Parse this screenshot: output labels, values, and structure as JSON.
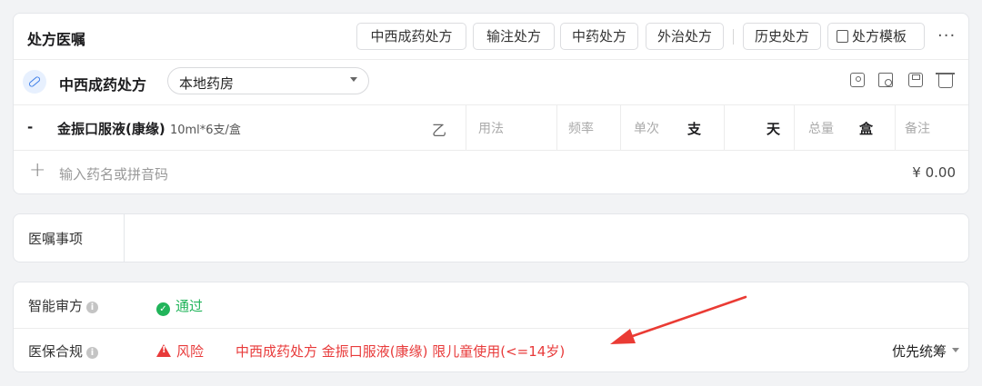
{
  "prescription": {
    "title": "处方医嘱",
    "tabs": [
      "中西成药处方",
      "输注处方",
      "中药处方",
      "外治处方",
      "历史处方",
      "处方模板"
    ],
    "more_label": "···",
    "sub_title": "中西成药处方",
    "pharmacy_select": "本地药房",
    "row": {
      "dash": "-",
      "drug_name": "金振口服液(康缘)",
      "drug_spec": "10ml*6支/盒",
      "insurance_class": "乙",
      "usage_placeholder": "用法",
      "frequency_placeholder": "频率",
      "single_dose_placeholder": "单次",
      "single_dose_unit": "支",
      "days_unit": "天",
      "total_placeholder": "总量",
      "total_unit": "盒",
      "note_placeholder": "备注"
    },
    "add_placeholder": "输入药名或拼音码",
    "add_plus": "+",
    "total_price": "¥ 0.00"
  },
  "advice": {
    "label": "医嘱事项",
    "value": ""
  },
  "audit": {
    "smart_label": "智能审方",
    "smart_status": "通过",
    "insurance_label": "医保合规",
    "insurance_status": "风险",
    "insurance_message": "中西成药处方 金振口服液(康缘) 限儿童使用(<=14岁)",
    "priority_select": "优先统筹",
    "info_glyph": "i",
    "check_glyph": "✓"
  },
  "colors": {
    "pass_green": "#21b45a",
    "risk_red": "#e83a3a",
    "accent_blue": "#3d7ee8"
  }
}
